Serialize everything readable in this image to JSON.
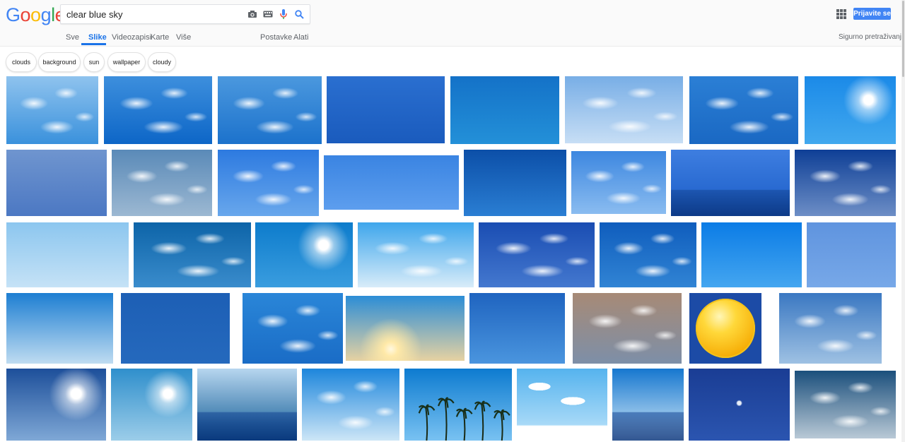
{
  "header": {
    "logo_letters": [
      "G",
      "o",
      "o",
      "g",
      "l",
      "e"
    ],
    "logo_colors": [
      "#4285f4",
      "#ea4335",
      "#fbbc05",
      "#4285f4",
      "#34a853",
      "#ea4335"
    ],
    "search_query": "clear blue sky",
    "signin_label": "Prijavite se"
  },
  "tabs": {
    "sve": "Sve",
    "slike": "Slike",
    "videozapisi": "Videozapisi",
    "karte": "Karte",
    "vise": "Više",
    "postavke": "Postavke",
    "alati": "Alati"
  },
  "safesearch_label": "Sigurno pretraživanje ▾",
  "chips": [
    "clouds",
    "background",
    "sun",
    "wallpaper",
    "cloudy"
  ],
  "colors": {
    "accent": "#1a73e8",
    "signin": "#4285f4"
  },
  "images": [
    {
      "style": "cloud",
      "colors": [
        "#8fc3ee",
        "#3a91dc"
      ]
    },
    {
      "style": "cloud",
      "colors": [
        "#3d8fdd",
        "#0d66c7"
      ]
    },
    {
      "style": "cloud",
      "colors": [
        "#4b98de",
        "#1c72cc"
      ]
    },
    {
      "style": "plain",
      "colors": [
        "#2a6fd0",
        "#1a5bbd"
      ]
    },
    {
      "style": "plain",
      "colors": [
        "#1472c8",
        "#2390d8"
      ]
    },
    {
      "style": "cloud",
      "colors": [
        "#78aee6",
        "#c7def5"
      ]
    },
    {
      "style": "cloud",
      "colors": [
        "#2b7fd5",
        "#1a68c3"
      ]
    },
    {
      "style": "sun",
      "colors": [
        "#1b8ae8",
        "#41a8ee"
      ]
    },
    {
      "style": "plain",
      "colors": [
        "#6f95cf",
        "#4c78c3"
      ]
    },
    {
      "style": "cloud",
      "colors": [
        "#5a8ab8",
        "#9cb8d2"
      ]
    },
    {
      "style": "cloud",
      "colors": [
        "#2d7ae0",
        "#68a7ec"
      ]
    },
    {
      "style": "plain",
      "colors": [
        "#3a84e2",
        "#5d9eee"
      ]
    },
    {
      "style": "plain",
      "colors": [
        "#0c4fa8",
        "#2a7ed3"
      ]
    },
    {
      "style": "cloud",
      "colors": [
        "#3d87e0",
        "#8abcf0"
      ]
    },
    {
      "style": "sea",
      "colors": [
        "#3e7ee0",
        "#1a5cc7"
      ]
    },
    {
      "style": "cloud",
      "colors": [
        "#0e3f96",
        "#6d8ec6"
      ]
    },
    {
      "style": "plain",
      "colors": [
        "#8cc6ef",
        "#c5e2f6"
      ]
    },
    {
      "style": "cloud",
      "colors": [
        "#0d64a8",
        "#3a8ccc"
      ]
    },
    {
      "style": "sun",
      "colors": [
        "#0d7ccc",
        "#3a9ddf"
      ]
    },
    {
      "style": "cloud",
      "colors": [
        "#3ea6ec",
        "#d8ecf9"
      ]
    },
    {
      "style": "cloud",
      "colors": [
        "#1a4db2",
        "#4478cf"
      ]
    },
    {
      "style": "cloud",
      "colors": [
        "#0f5dbd",
        "#3184d4"
      ]
    },
    {
      "style": "plain",
      "colors": [
        "#0b7ce6",
        "#44a6f0"
      ]
    },
    {
      "style": "plain",
      "colors": [
        "#5f94df",
        "#77a8e8"
      ]
    },
    {
      "style": "plain",
      "colors": [
        "#1d7ed2",
        "#bfdcf1"
      ]
    },
    {
      "style": "plain",
      "colors": [
        "#1d5fb5",
        "#2569bd"
      ]
    },
    {
      "style": "cloud",
      "colors": [
        "#2a86d8",
        "#1a6cc6"
      ]
    },
    {
      "style": "sunset",
      "colors": [
        "#2c8dd6",
        "#e6d2a2"
      ]
    },
    {
      "style": "plain",
      "colors": [
        "#1f64c0",
        "#4a95de"
      ]
    },
    {
      "style": "cloud",
      "colors": [
        "#a78a76",
        "#7d8fa8"
      ]
    },
    {
      "style": "ball",
      "colors": [
        "#1c4ba6",
        "#ffc400"
      ]
    },
    {
      "style": "cloud",
      "colors": [
        "#3a78c2",
        "#9ec1e3"
      ]
    },
    {
      "style": "sun",
      "colors": [
        "#1d4f9a",
        "#7fa8d6"
      ]
    },
    {
      "style": "sun",
      "colors": [
        "#2f8fcc",
        "#9ccde9"
      ]
    },
    {
      "style": "sea",
      "colors": [
        "#b7d6ef",
        "#0f5a94"
      ]
    },
    {
      "style": "cloud",
      "colors": [
        "#1d86dc",
        "#cde6f7"
      ]
    },
    {
      "style": "palm",
      "colors": [
        "#0d7bd0",
        "#79c2f2"
      ]
    },
    {
      "style": "cartoon",
      "colors": [
        "#55b3ee",
        "#bfe4fa"
      ]
    },
    {
      "style": "sea",
      "colors": [
        "#1677cf",
        "#d6ebf8"
      ]
    },
    {
      "style": "moon",
      "colors": [
        "#1a3d94",
        "#2b55b0"
      ]
    },
    {
      "style": "cloud",
      "colors": [
        "#1b4f7c",
        "#b9c9d6"
      ]
    }
  ]
}
